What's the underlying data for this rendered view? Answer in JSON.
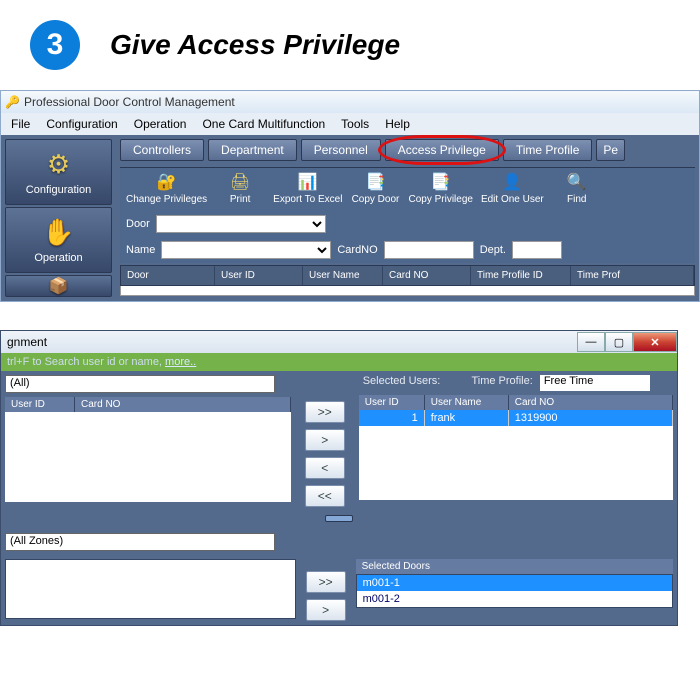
{
  "step": {
    "number": "3",
    "title": "Give Access Privilege"
  },
  "window": {
    "title": "Professional Door Control Management",
    "menu": [
      "File",
      "Configuration",
      "Operation",
      "One Card Multifunction",
      "Tools",
      "Help"
    ]
  },
  "sidebar": [
    {
      "label": "Configuration"
    },
    {
      "label": "Operation"
    }
  ],
  "tabs": [
    "Controllers",
    "Department",
    "Personnel",
    "Access Privilege",
    "Time Profile",
    "Pe"
  ],
  "tools": [
    {
      "label": "Change Privileges"
    },
    {
      "label": "Print"
    },
    {
      "label": "Export To Excel"
    },
    {
      "label": "Copy Door"
    },
    {
      "label": "Copy Privilege"
    },
    {
      "label": "Edit One User"
    },
    {
      "label": "Find"
    }
  ],
  "filters": {
    "door_label": "Door",
    "name_label": "Name",
    "cardno_label": "CardNO",
    "dept_label": "Dept."
  },
  "grid_columns": [
    "Door",
    "User ID",
    "User Name",
    "Card NO",
    "Time Profile ID",
    "Time Prof"
  ],
  "dialog": {
    "title_fragment": "gnment",
    "hint_a": "trl+F",
    "hint_b": " to Search user id or name, ",
    "hint_more": "more..",
    "dept_value": "(All)",
    "user_grid_cols": [
      "User ID",
      "Card NO"
    ],
    "selected_users_label": "Selected Users:",
    "time_profile_label": "Time Profile:",
    "time_profile_value": "Free Time",
    "sel_user_cols": [
      "User ID",
      "User Name",
      "Card NO"
    ],
    "sel_user_row": {
      "id": "1",
      "name": "frank",
      "card": "1319900"
    },
    "zone_value": "(All Zones)",
    "selected_doors_label": "Selected Doors",
    "doors": [
      "m001-1",
      "m001-2"
    ],
    "btn_add_all": ">>",
    "btn_add": ">",
    "btn_rem": "<",
    "btn_rem_all": "<<"
  }
}
